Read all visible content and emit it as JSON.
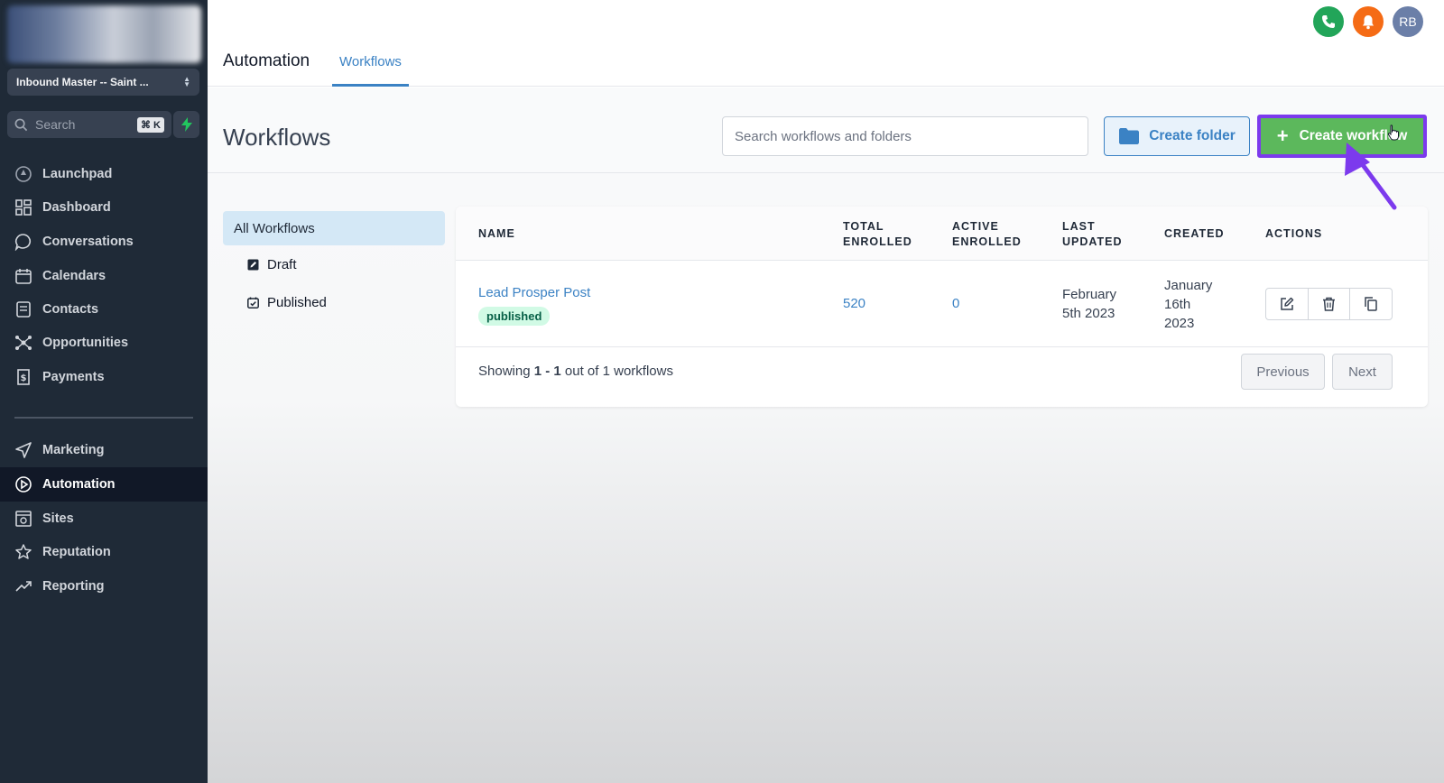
{
  "sidebar": {
    "account": "Inbound Master -- Saint ...",
    "search_placeholder": "Search",
    "search_shortcut": "⌘ K",
    "items": [
      {
        "label": "Launchpad",
        "icon": "rocket-icon"
      },
      {
        "label": "Dashboard",
        "icon": "grid-icon"
      },
      {
        "label": "Conversations",
        "icon": "chat-icon"
      },
      {
        "label": "Calendars",
        "icon": "calendar-icon"
      },
      {
        "label": "Contacts",
        "icon": "contacts-icon"
      },
      {
        "label": "Opportunities",
        "icon": "network-icon"
      },
      {
        "label": "Payments",
        "icon": "receipt-icon"
      },
      {
        "label": "Marketing",
        "icon": "send-icon"
      },
      {
        "label": "Automation",
        "icon": "automation-icon"
      },
      {
        "label": "Sites",
        "icon": "globe-icon"
      },
      {
        "label": "Reputation",
        "icon": "star-icon"
      },
      {
        "label": "Reporting",
        "icon": "trend-icon"
      }
    ],
    "active_item": "Automation"
  },
  "topbar": {
    "title": "Automation",
    "tab": "Workflows",
    "avatar_initials": "RB",
    "phone_color": "#22a559",
    "bell_color": "#f56b15",
    "avatar_color": "#6b7fa8"
  },
  "workflows": {
    "title": "Workflows",
    "search_placeholder": "Search workflows and folders",
    "create_folder_label": "Create folder",
    "create_workflow_label": "Create workflow",
    "folders": {
      "all": "All Workflows",
      "draft": "Draft",
      "published": "Published"
    },
    "table": {
      "headers": {
        "name": "NAME",
        "total_enrolled_1": "TOTAL",
        "total_enrolled_2": "ENROLLED",
        "active_enrolled_1": "ACTIVE",
        "active_enrolled_2": "ENROLLED",
        "last_updated_1": "LAST",
        "last_updated_2": "UPDATED",
        "created": "CREATED",
        "actions": "ACTIONS"
      },
      "rows": [
        {
          "name": "Lead Prosper Post",
          "status": "published",
          "total_enrolled": "520",
          "active_enrolled": "0",
          "last_updated_1": "February",
          "last_updated_2": "5th 2023",
          "created_1": "January",
          "created_2": "16th",
          "created_3": "2023"
        }
      ]
    },
    "pagination": {
      "showing_prefix": "Showing ",
      "range": "1 - 1",
      "suffix": " out of 1 workflows",
      "previous": "Previous",
      "next": "Next"
    }
  },
  "colors": {
    "accent_blue": "#3b82c4",
    "create_green": "#5cb85c",
    "highlight_purple": "#7c3aed",
    "sidebar_bg": "#1f2a37"
  }
}
